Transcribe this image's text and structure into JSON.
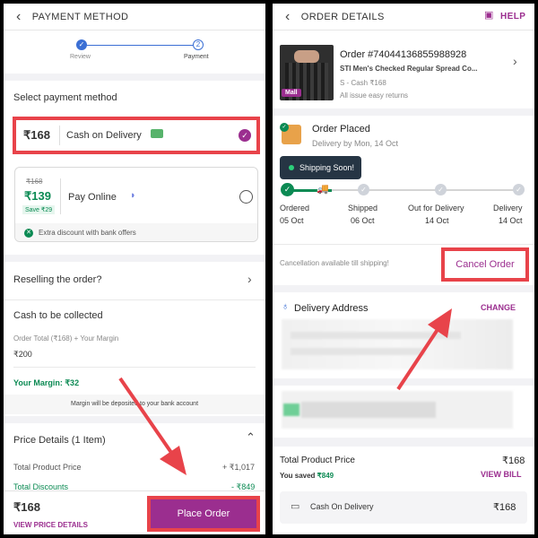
{
  "left": {
    "header_title": "PAYMENT METHOD",
    "steps": [
      {
        "label": "Review",
        "num": ""
      },
      {
        "label": "Payment",
        "num": "2"
      }
    ],
    "section_title": "Select payment method",
    "cod": {
      "amount": "₹168",
      "label": "Cash on Delivery"
    },
    "online": {
      "old_price": "₹168",
      "price": "₹139",
      "save": "Save ₹29",
      "label": "Pay Online",
      "offer": "Extra discount with bank offers"
    },
    "reselling": "Reselling the order?",
    "cash_collect_title": "Cash to be collected",
    "order_total_label": "Order Total (₹168) + Your Margin",
    "order_total_value": "₹200",
    "margin": "Your Margin: ₹32",
    "margin_note": "Margin will be deposited to your bank account",
    "price_details_title": "Price Details (1 Item)",
    "price_rows": [
      {
        "label": "Total Product Price",
        "value": "+ ₹1,017"
      },
      {
        "label": "Total Discounts",
        "value": "- ₹849"
      }
    ],
    "footer_amount": "₹168",
    "view_price_details": "VIEW PRICE DETAILS",
    "place_order": "Place Order"
  },
  "right": {
    "header_title": "ORDER DETAILS",
    "help": "HELP",
    "order_title": "Order #74044136855988928",
    "product_name": "STI Men's Checked Regular Spread Co...",
    "size_payment": "S - Cash ₹168",
    "returns": "All issue easy returns",
    "mall_badge": "Mall",
    "status_title": "Order Placed",
    "delivery_by": "Delivery by Mon, 14 Oct",
    "tooltip": "Shipping Soon!",
    "track_steps": [
      {
        "label": "Ordered",
        "date": "05 Oct"
      },
      {
        "label": "Shipped",
        "date": "06 Oct"
      },
      {
        "label": "Out for Delivery",
        "date": "14 Oct"
      },
      {
        "label": "Delivery",
        "date": "14 Oct"
      }
    ],
    "cancel_note": "Cancellation available till shipping!",
    "cancel_button": "Cancel Order",
    "address_title": "Delivery Address",
    "change": "CHANGE",
    "total_label": "Total Product Price",
    "total_value": "₹168",
    "saved_prefix": "You saved",
    "saved_value": "₹849",
    "view_bill": "VIEW BILL",
    "payment_label": "Cash On Delivery",
    "payment_value": "₹168"
  },
  "colors": {
    "accent": "#9b2e8f",
    "red": "#e8434a",
    "green": "#0b8a53",
    "blue": "#3b6fd4"
  }
}
